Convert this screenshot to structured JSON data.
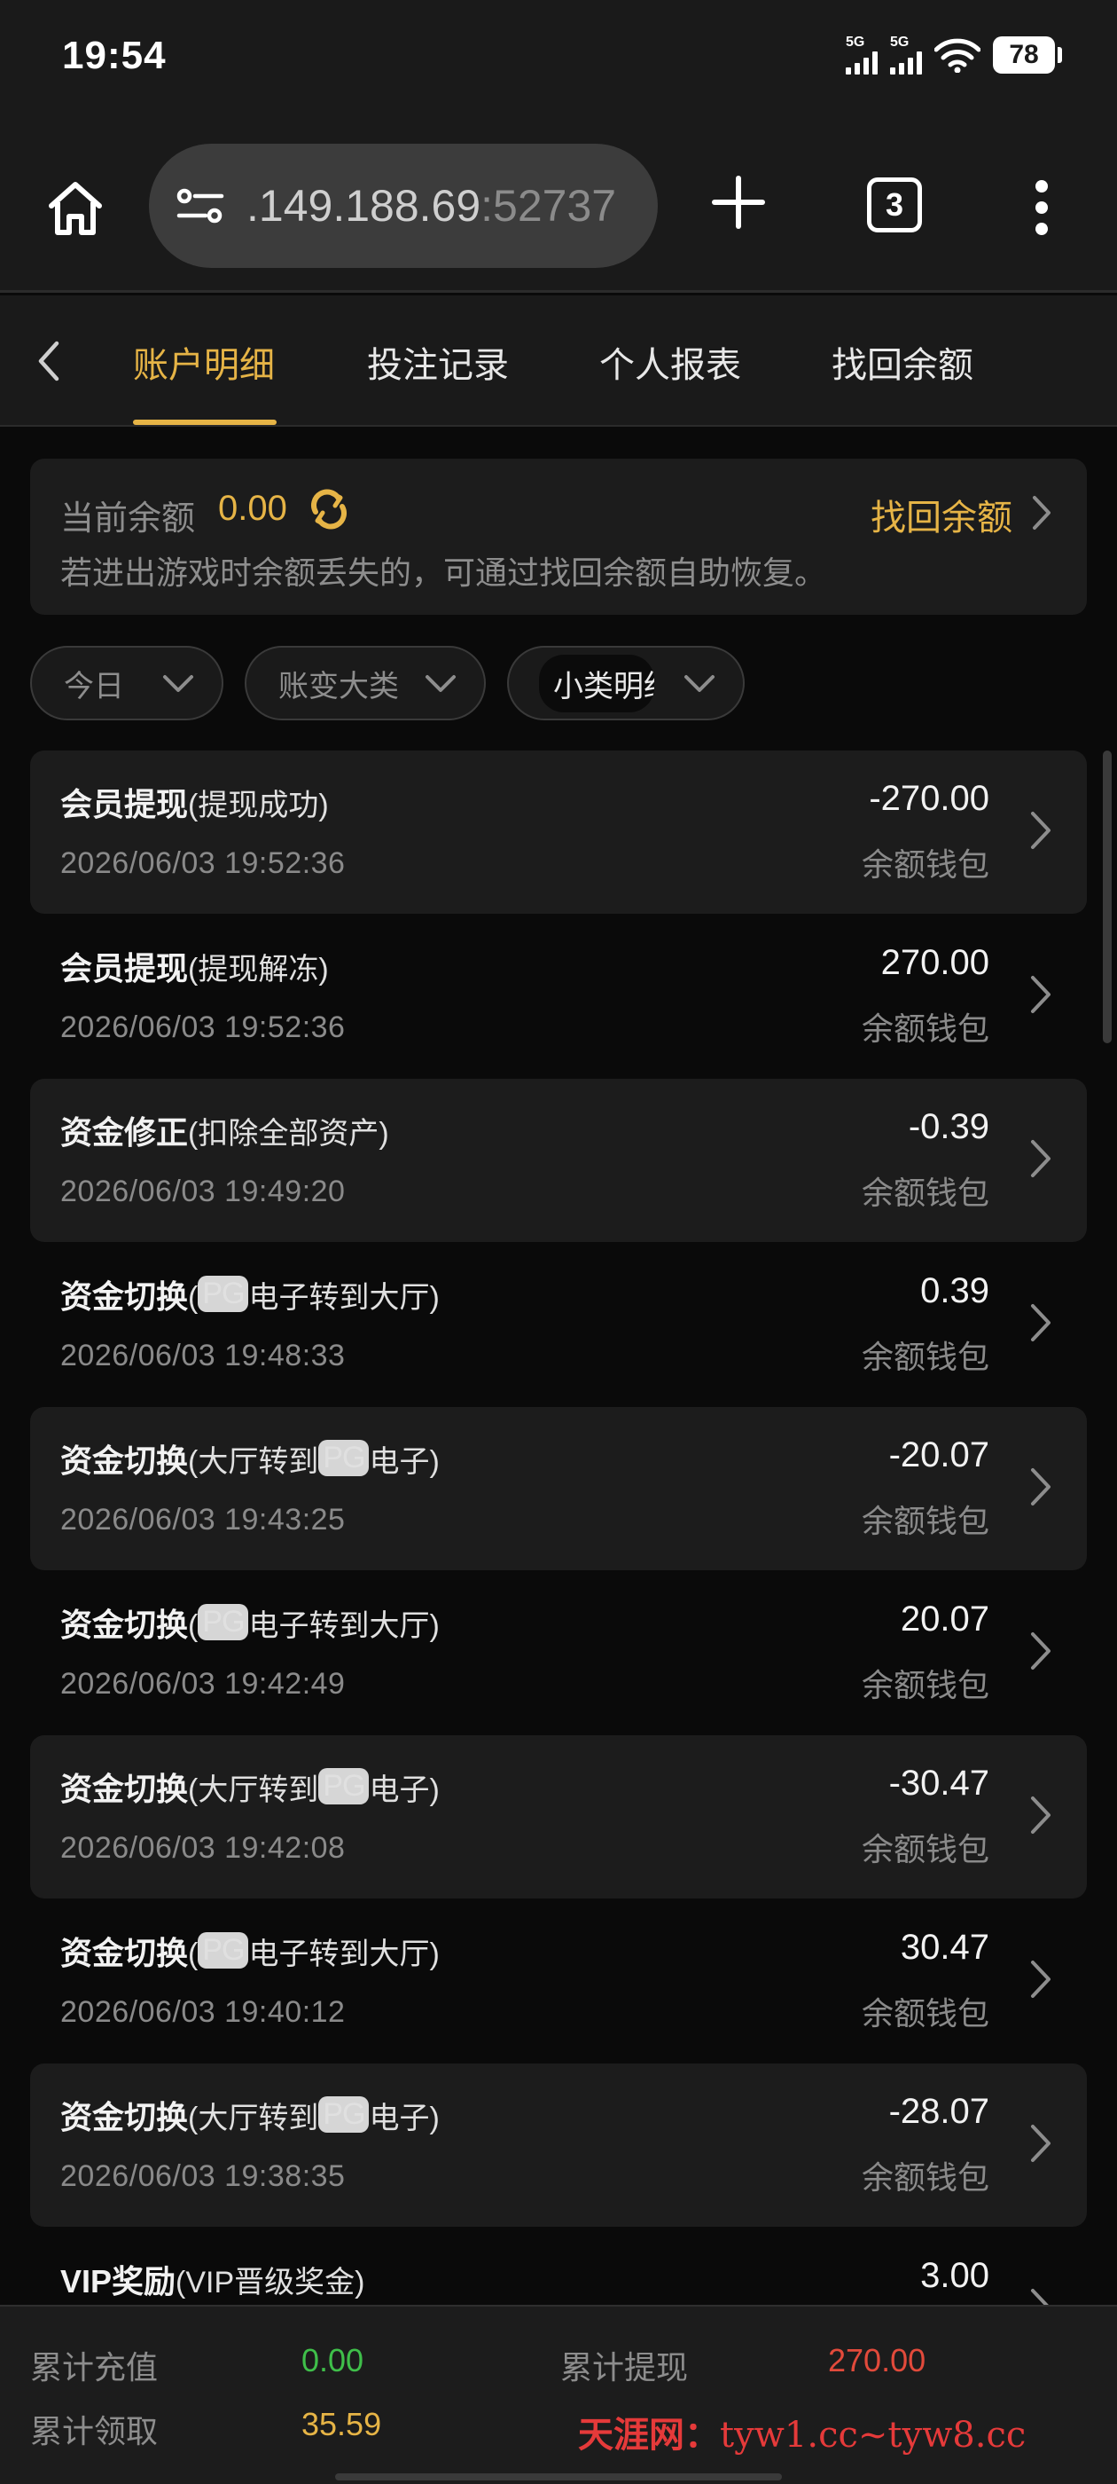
{
  "status_bar": {
    "time": "19:54",
    "signal_1": "5G",
    "signal_2": "5G",
    "battery": "78",
    "icons": [
      "signal-icon",
      "signal-icon",
      "wifi-icon",
      "battery-icon"
    ]
  },
  "browser": {
    "url_host": ".149.188.69",
    "url_port": ":52737",
    "tab_count": "3",
    "icons": [
      "home-icon",
      "site-settings-icon",
      "plus-icon",
      "tabs-icon",
      "more-vertical-icon"
    ]
  },
  "nav": {
    "tabs": [
      "账户明细",
      "投注记录",
      "个人报表",
      "找回余额"
    ],
    "active_index": 0
  },
  "balance": {
    "label": "当前余额",
    "value": "0.00",
    "recover_label": "找回余额",
    "note": "若进出游戏时余额丢失的，可通过找回余额自助恢复。"
  },
  "filters": [
    {
      "label": "今日"
    },
    {
      "label": "账变大类"
    },
    {
      "label": "小类明细"
    }
  ],
  "records": [
    {
      "type": "会员提现",
      "pre": "(提现成功)",
      "pg": "",
      "post": "",
      "date": "2026/06/03 19:52:36",
      "amount": "-270.00",
      "wallet": "余额钱包"
    },
    {
      "type": "会员提现",
      "pre": "(提现解冻)",
      "pg": "",
      "post": "",
      "date": "2026/06/03 19:52:36",
      "amount": "270.00",
      "wallet": "余额钱包"
    },
    {
      "type": "资金修正",
      "pre": "(扣除全部资产)",
      "pg": "",
      "post": "",
      "date": "2026/06/03 19:49:20",
      "amount": "-0.39",
      "wallet": "余额钱包"
    },
    {
      "type": "资金切换",
      "pre": "(",
      "pg": "PG",
      "post": "电子转到大厅)",
      "date": "2026/06/03 19:48:33",
      "amount": "0.39",
      "wallet": "余额钱包"
    },
    {
      "type": "资金切换",
      "pre": "(大厅转到",
      "pg": "PG",
      "post": "电子)",
      "date": "2026/06/03 19:43:25",
      "amount": "-20.07",
      "wallet": "余额钱包"
    },
    {
      "type": "资金切换",
      "pre": "(",
      "pg": "PG",
      "post": "电子转到大厅)",
      "date": "2026/06/03 19:42:49",
      "amount": "20.07",
      "wallet": "余额钱包"
    },
    {
      "type": "资金切换",
      "pre": "(大厅转到",
      "pg": "PG",
      "post": "电子)",
      "date": "2026/06/03 19:42:08",
      "amount": "-30.47",
      "wallet": "余额钱包"
    },
    {
      "type": "资金切换",
      "pre": "(",
      "pg": "PG",
      "post": "电子转到大厅)",
      "date": "2026/06/03 19:40:12",
      "amount": "30.47",
      "wallet": "余额钱包"
    },
    {
      "type": "资金切换",
      "pre": "(大厅转到",
      "pg": "PG",
      "post": "电子)",
      "date": "2026/06/03 19:38:35",
      "amount": "-28.07",
      "wallet": "余额钱包"
    },
    {
      "type": "VIP奖励",
      "pre": "(VIP晋级奖金)",
      "pg": "",
      "post": "",
      "date": "",
      "amount": "3.00",
      "wallet": ""
    }
  ],
  "footer": {
    "total_deposit_label": "累计充值",
    "total_deposit": "0.00",
    "total_withdraw_label": "累计提现",
    "total_withdraw": "270.00",
    "total_claim_label": "累计领取",
    "total_claim": "35.59",
    "watermark_site": "天涯网：",
    "watermark_domain": "tyw1.cc~tyw8.cc"
  },
  "colors": {
    "accent": "#e6b446",
    "deposit": "#3fbf4a",
    "withdraw": "#e24a3b",
    "claim": "#e6b446"
  }
}
